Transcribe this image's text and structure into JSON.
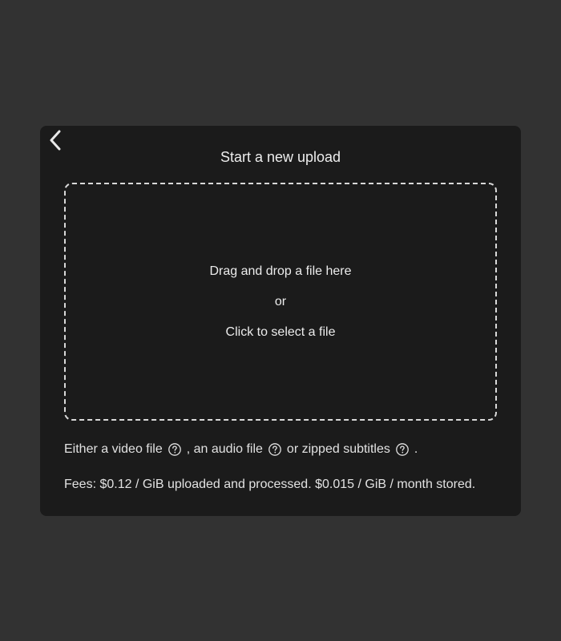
{
  "dialog": {
    "title": "Start a new upload",
    "back_icon": "chevron-left-icon"
  },
  "dropzone": {
    "line1": "Drag and drop a file here",
    "line2": "or",
    "line3": "Click to select a file"
  },
  "info": {
    "part1": "Either a video file",
    "part2": ", an audio file",
    "part3": "or zipped subtitles",
    "part4": ".",
    "help_icon": "question-circle-icon"
  },
  "fees": {
    "text": "Fees: $0.12 / GiB uploaded and processed. $0.015 / GiB / month stored."
  }
}
